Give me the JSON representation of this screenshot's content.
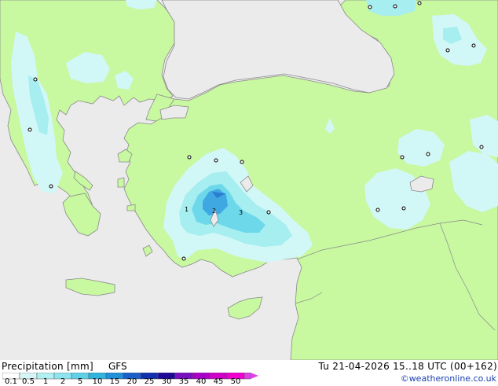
{
  "title": "Precipitation [mm]",
  "model": "GFS",
  "valid_time": "Tu 21-04-2026 15..18 UTC (00+162)",
  "credit": "©weatheronline.co.uk",
  "colors": {
    "sea": "#ebebeb",
    "land": "#c8f8a0",
    "coast": "#8a8a8a",
    "precip_light": "#d2f7f7",
    "precip_mid": "#a6eef0",
    "precip_high": "#6dd8ea",
    "precip_max": "#3fa7e2"
  },
  "legend": {
    "ticks": [
      "0.1",
      "0.5",
      "1",
      "2",
      "5",
      "10",
      "15",
      "20",
      "25",
      "30",
      "35",
      "40",
      "45",
      "50"
    ],
    "colors": [
      "#ffffff",
      "#d6f6f6",
      "#b2eff2",
      "#8ee4ee",
      "#5fd0e6",
      "#30b4de",
      "#2090d8",
      "#1a60c8",
      "#1030b0",
      "#200898",
      "#7810c0",
      "#a800c8",
      "#d000c8",
      "#f000d0",
      "#e040e8"
    ]
  },
  "map_labels": [
    "1",
    "2",
    "3"
  ]
}
